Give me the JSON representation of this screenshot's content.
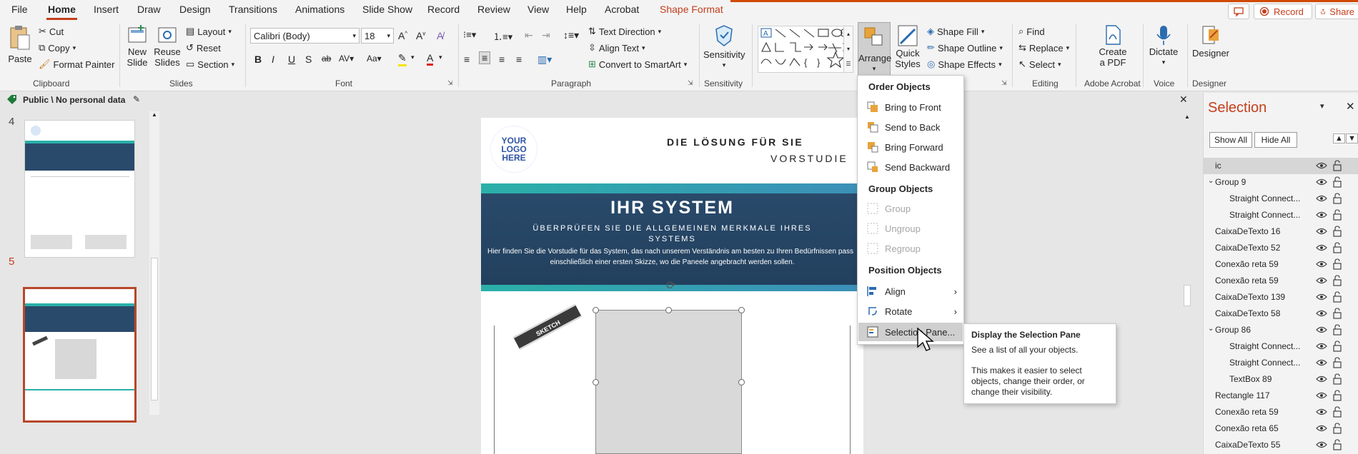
{
  "tabs": [
    "File",
    "Home",
    "Insert",
    "Draw",
    "Design",
    "Transitions",
    "Animations",
    "Slide Show",
    "Record",
    "Review",
    "View",
    "Help",
    "Acrobat",
    "Shape Format"
  ],
  "tab_actions": {
    "record": "Record",
    "share": "Share"
  },
  "clipboard": {
    "paste": "Paste",
    "cut": "Cut",
    "copy": "Copy",
    "format_painter": "Format Painter",
    "label": "Clipboard"
  },
  "slides": {
    "new_slide_1": "New",
    "new_slide_2": "Slide",
    "reuse_1": "Reuse",
    "reuse_2": "Slides",
    "layout": "Layout",
    "reset": "Reset",
    "section": "Section",
    "label": "Slides"
  },
  "font": {
    "name": "Calibri (Body)",
    "size": "18",
    "label": "Font"
  },
  "paragraph": {
    "text_direction": "Text Direction",
    "align_text": "Align Text",
    "convert_smartart": "Convert to SmartArt",
    "label": "Paragraph"
  },
  "sensitivity": {
    "button": "Sensitivity",
    "label": "Sensitivity"
  },
  "drawing": {
    "arrange": "Arrange",
    "quick_1": "Quick",
    "quick_2": "Styles",
    "shape_fill": "Shape Fill",
    "shape_outline": "Shape Outline",
    "shape_effects": "Shape Effects"
  },
  "editing": {
    "find": "Find",
    "replace": "Replace",
    "select": "Select",
    "label": "Editing"
  },
  "acrobat": {
    "create_1": "Create",
    "create_2": "a PDF",
    "label": "Adobe Acrobat"
  },
  "voice": {
    "dictate": "Dictate",
    "label": "Voice"
  },
  "designer": {
    "button": "Designer",
    "label": "Designer"
  },
  "infobar": {
    "label": "Public \\ No personal data"
  },
  "thumbnails": [
    {
      "num": "4"
    },
    {
      "num": "5"
    }
  ],
  "slide": {
    "logo": "YOUR LOGO HERE",
    "heading": "DIE LÖSUNG FÜR SIE",
    "subheading": "VORSTUDIE",
    "banner_title": "IHR SYSTEM",
    "banner_sub_1": "ÜBERPRÜFEN SIE DIE ALLGEMEINEN MERKMALE IHRES",
    "banner_sub_2": "SYSTEMS",
    "body_1": "Hier finden Sie die Vorstudie für das System, das nach unserem Verständnis am besten zu Ihren Bedürfnissen pass",
    "body_2": "einschließlich einer ersten Skizze, wo die Paneele angebracht werden sollen.",
    "sketch": "SKETCH"
  },
  "menu": {
    "h_order": "Order Objects",
    "bring_front": "Bring to Front",
    "send_back": "Send to Back",
    "bring_forward": "Bring Forward",
    "send_backward": "Send Backward",
    "h_group": "Group Objects",
    "group": "Group",
    "ungroup": "Ungroup",
    "regroup": "Regroup",
    "h_position": "Position Objects",
    "align": "Align",
    "rotate": "Rotate",
    "selection_pane": "Selection Pane..."
  },
  "tooltip": {
    "title": "Display the Selection Pane",
    "line1": "See a list of all your objects.",
    "line2": "This makes it easier to select objects, change their order, or change their visibility."
  },
  "selection": {
    "title": "Selection",
    "show_all": "Show All",
    "hide_all": "Hide All",
    "items": [
      {
        "name": "ic",
        "indent": 0,
        "caret": ""
      },
      {
        "name": "Group 9",
        "indent": 0,
        "caret": "down"
      },
      {
        "name": "Straight Connect...",
        "indent": 1,
        "caret": ""
      },
      {
        "name": "Straight Connect...",
        "indent": 1,
        "caret": ""
      },
      {
        "name": "CaixaDeTexto 16",
        "indent": 0,
        "caret": ""
      },
      {
        "name": "CaixaDeTexto 52",
        "indent": 0,
        "caret": ""
      },
      {
        "name": "Conexão reta 59",
        "indent": 0,
        "caret": ""
      },
      {
        "name": "Conexão reta 59",
        "indent": 0,
        "caret": ""
      },
      {
        "name": "CaixaDeTexto 139",
        "indent": 0,
        "caret": ""
      },
      {
        "name": "CaixaDeTexto 58",
        "indent": 0,
        "caret": ""
      },
      {
        "name": "Group 86",
        "indent": 0,
        "caret": "down"
      },
      {
        "name": "Straight Connect...",
        "indent": 1,
        "caret": ""
      },
      {
        "name": "Straight Connect...",
        "indent": 1,
        "caret": ""
      },
      {
        "name": "TextBox 89",
        "indent": 1,
        "caret": ""
      },
      {
        "name": "Rectangle 117",
        "indent": 0,
        "caret": ""
      },
      {
        "name": "Conexão reta 59",
        "indent": 0,
        "caret": ""
      },
      {
        "name": "Conexão reta 65",
        "indent": 0,
        "caret": ""
      },
      {
        "name": "CaixaDeTexto 55",
        "indent": 0,
        "caret": ""
      }
    ]
  },
  "colors": {
    "accent": "#c43e1c",
    "banner": "#2a4a6b",
    "teal": "#2ab0a8"
  }
}
